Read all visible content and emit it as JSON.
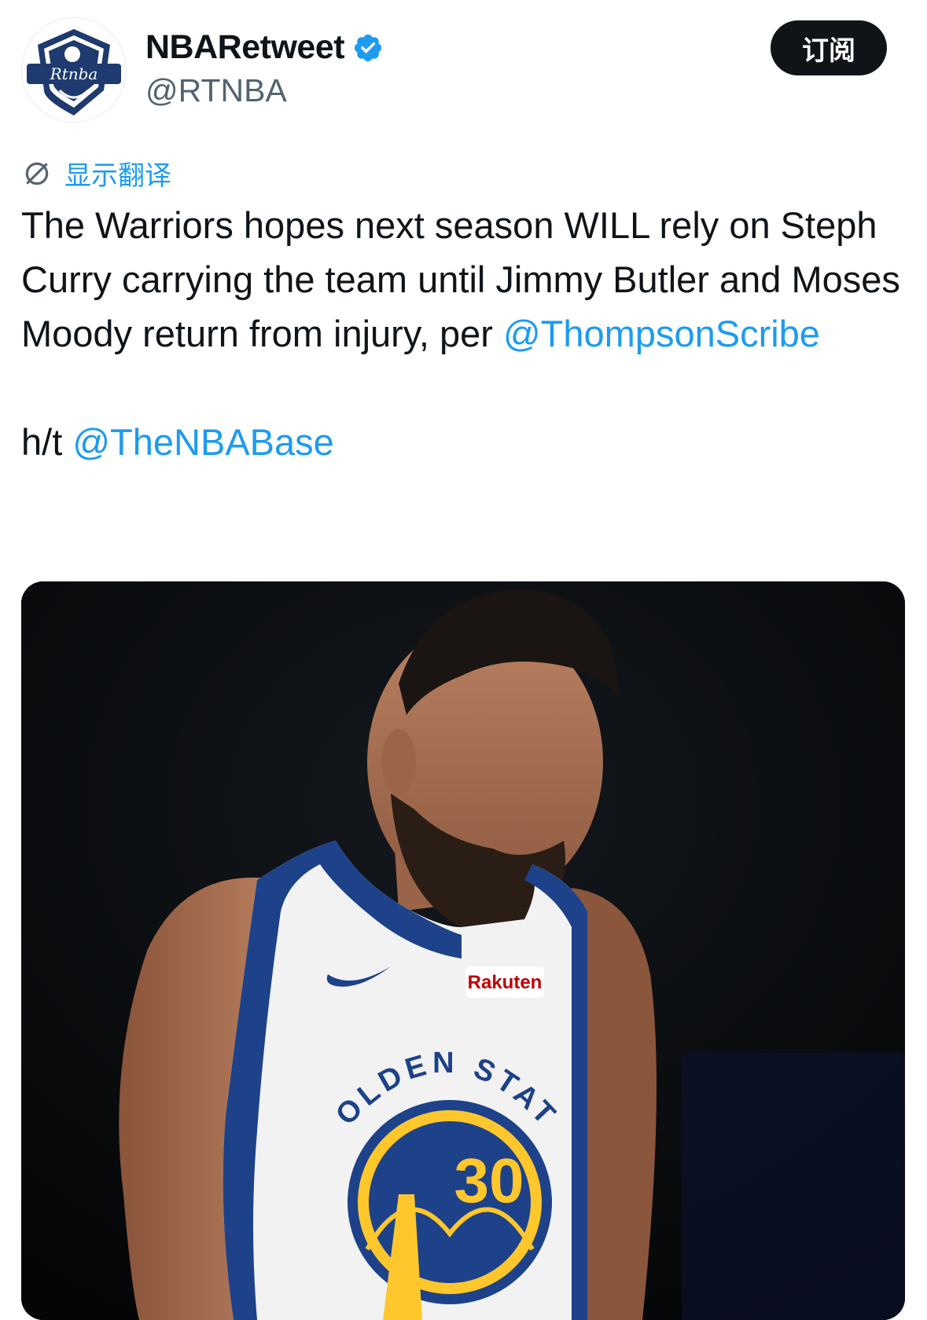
{
  "author": {
    "display_name": "NBARetweet",
    "handle": "@RTNBA",
    "avatar_text": "Rtnba",
    "verified": true
  },
  "subscribe_label": "订阅",
  "translate_label": "显示翻译",
  "tweet": {
    "line1": "The Warriors hopes next season WILL rely on Steph Curry carrying the team until Jimmy Butler and Moses Moody return from injury, per ",
    "mention1": "@ThompsonScribe",
    "ht_prefix": "h/t ",
    "mention2": "@TheNBABase"
  },
  "media": {
    "jersey_text": "GOLDEN STATE",
    "jersey_number": "30",
    "sponsor": "Rakuten"
  },
  "colors": {
    "link": "#1d9bf0",
    "text": "#0f1419",
    "secondary": "#536471",
    "warriors_blue": "#1d428a",
    "warriors_gold": "#ffc72c"
  }
}
